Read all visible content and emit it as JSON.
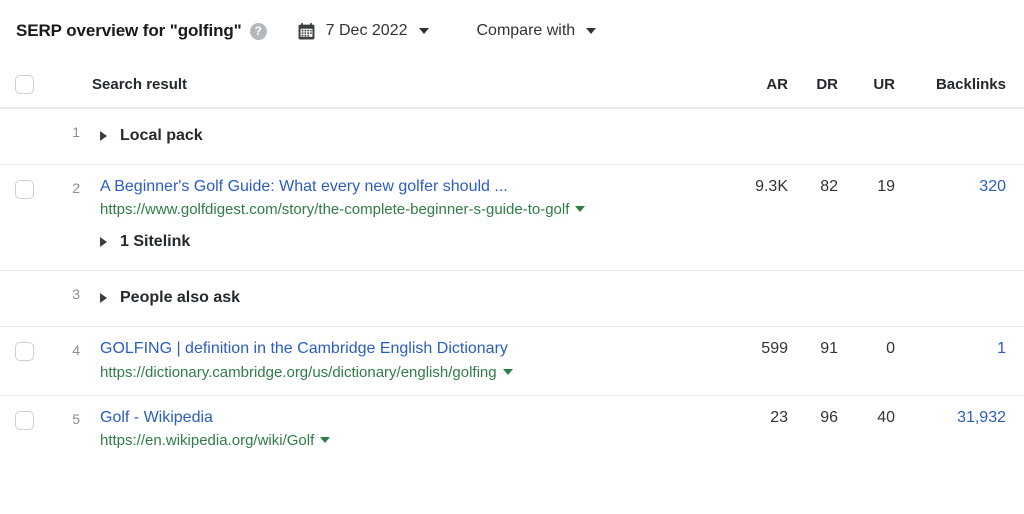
{
  "toolbar": {
    "title": "SERP overview for \"golfing\"",
    "help_icon": "question-mark-circle-icon",
    "help_glyph": "?",
    "calendar_icon": "calendar-icon",
    "date": "7 Dec 2022",
    "date_caret_icon": "chevron-down-icon",
    "compare_label": "Compare with",
    "compare_caret_icon": "chevron-down-icon"
  },
  "table": {
    "headers": {
      "select_all": "select-all-checkbox",
      "search_result": "Search result",
      "ar": "AR",
      "dr": "DR",
      "ur": "UR",
      "backlinks": "Backlinks"
    },
    "rows": [
      {
        "kind": "group",
        "rank": "1",
        "label": "Local pack",
        "checkbox": false,
        "ar": "",
        "dr": "",
        "ur": "",
        "backlinks": ""
      },
      {
        "kind": "result",
        "rank": "2",
        "checkbox": true,
        "title": "A Beginner's Golf Guide: What every new golfer should ...",
        "url": "https://www.golfdigest.com/story/the-complete-beginner-s-guide-to-golf",
        "ar": "9.3K",
        "dr": "82",
        "ur": "19",
        "backlinks": "320",
        "sitelink_label": "1 Sitelink"
      },
      {
        "kind": "group",
        "rank": "3",
        "label": "People also ask",
        "checkbox": false,
        "ar": "",
        "dr": "",
        "ur": "",
        "backlinks": ""
      },
      {
        "kind": "result",
        "rank": "4",
        "checkbox": true,
        "title": "GOLFING | definition in the Cambridge English Dictionary",
        "url": "https://dictionary.cambridge.org/us/dictionary/english/golfing",
        "ar": "599",
        "dr": "91",
        "ur": "0",
        "backlinks": "1"
      },
      {
        "kind": "result",
        "rank": "5",
        "checkbox": true,
        "title": "Golf - Wikipedia",
        "url": "https://en.wikipedia.org/wiki/Golf",
        "ar": "23",
        "dr": "96",
        "ur": "40",
        "backlinks": "31,932"
      }
    ]
  },
  "colors": {
    "link_blue": "#2b5dc0",
    "url_green": "#2f7d47",
    "text_dark": "#333333",
    "rank_gray": "#8a8f94",
    "divider": "#e8eaec"
  }
}
